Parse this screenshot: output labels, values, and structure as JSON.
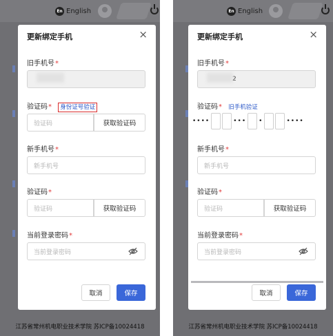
{
  "header": {
    "language_label": "English",
    "language_badge": "En"
  },
  "dialog": {
    "title": "更新绑定手机",
    "old_phone_label": "旧手机号",
    "old_phone_value_left": "",
    "old_phone_value_right": "2",
    "code_label": "验证码",
    "id_verify_link": "身份证号验证",
    "old_phone_verify_link": "旧手机验证",
    "code_placeholder": "验证码",
    "get_code_button": "获取验证码",
    "new_phone_label": "新手机号",
    "new_phone_placeholder": "新手机号",
    "new_code_label": "验证码",
    "new_code_placeholder": "验证码",
    "password_label": "当前登录密码",
    "password_placeholder": "当前登录密码",
    "cancel_button": "取消",
    "save_button": "保存",
    "required_mark": "*",
    "close_symbol": "×"
  },
  "otp": {
    "dots_a": "••••",
    "dots_b": "•••",
    "dots_c": "•",
    "dots_d": "••••"
  },
  "footer": {
    "text": "江苏省常州机电职业技术学院 苏ICP备10024418"
  },
  "colors": {
    "accent": "#3a67d9",
    "required": "#e23b3b",
    "highlight": "#d92b2b",
    "link": "#2b58c8"
  }
}
